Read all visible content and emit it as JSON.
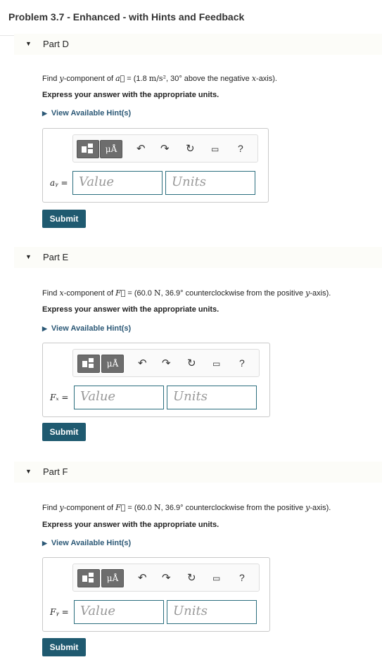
{
  "header": {
    "title": "Problem 3.7 - Enhanced - with Hints and Feedback"
  },
  "toolbar_icons": [
    "template-icon",
    "greek-units-icon",
    "undo-icon",
    "redo-icon",
    "reset-icon",
    "keyboard-icon",
    "help-icon"
  ],
  "toolbar": {
    "greek_label": "μÅ",
    "undo": "↶",
    "redo": "↷",
    "reset": "↻",
    "keyboard": "▭",
    "help": "?"
  },
  "colors": {
    "submit_bg": "#1f5a70",
    "hint_link": "#2b5876",
    "field_border": "#2b6e7e"
  },
  "parts": [
    {
      "label": "Part D",
      "question_pre": "Find ",
      "question_var": "y",
      "question_mid": "-component of ",
      "question_vec": "a⃗",
      "question_eq": " = (1.8 ",
      "question_unit": "m/s²",
      "question_post": ", 30° above the negative ",
      "question_axis": "x",
      "question_end": "-axis).",
      "instruction": "Express your answer with the appropriate units.",
      "hint": "View Available Hint(s)",
      "var_label": "aᵧ =",
      "value_placeholder": "Value",
      "units_placeholder": "Units",
      "submit": "Submit"
    },
    {
      "label": "Part E",
      "question_pre": "Find ",
      "question_var": "x",
      "question_mid": "-component of ",
      "question_vec": "F⃗",
      "question_eq": " = (60.0 ",
      "question_unit": "N",
      "question_post": ", 36.9° counterclockwise from the positive ",
      "question_axis": "y",
      "question_end": "-axis).",
      "instruction": "Express your answer with the appropriate units.",
      "hint": "View Available Hint(s)",
      "var_label": "Fₓ =",
      "value_placeholder": "Value",
      "units_placeholder": "Units",
      "submit": "Submit"
    },
    {
      "label": "Part F",
      "question_pre": "Find ",
      "question_var": "y",
      "question_mid": "-component of ",
      "question_vec": "F⃗",
      "question_eq": " = (60.0 ",
      "question_unit": "N",
      "question_post": ", 36.9° counterclockwise from the positive ",
      "question_axis": "y",
      "question_end": "-axis).",
      "instruction": "Express your answer with the appropriate units.",
      "hint": "View Available Hint(s)",
      "var_label": "Fᵧ =",
      "value_placeholder": "Value",
      "units_placeholder": "Units",
      "submit": "Submit"
    }
  ]
}
